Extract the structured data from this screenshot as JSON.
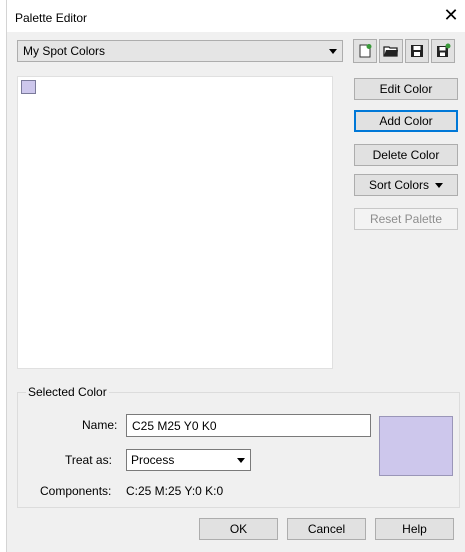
{
  "window": {
    "title": "Palette Editor",
    "close_glyph": "✕"
  },
  "palette": {
    "selected": "My Spot Colors"
  },
  "toolbar_icons": [
    "new-palette-icon",
    "open-palette-icon",
    "save-palette-icon",
    "save-as-palette-icon"
  ],
  "swatches": [
    {
      "color": "#cdc7ec"
    }
  ],
  "buttons": {
    "edit_color": "Edit Color",
    "add_color": "Add Color",
    "delete_color": "Delete Color",
    "sort_colors": "Sort Colors",
    "reset_palette": "Reset Palette"
  },
  "selected_color": {
    "group_title": "Selected Color",
    "name_label": "Name:",
    "name_value": "C25 M25 Y0 K0",
    "treat_label": "Treat as:",
    "treat_value": "Process",
    "components_label": "Components:",
    "components_value": "C:25 M:25 Y:0 K:0",
    "preview_color": "#cdc7ec"
  },
  "footer": {
    "ok": "OK",
    "cancel": "Cancel",
    "help": "Help"
  }
}
